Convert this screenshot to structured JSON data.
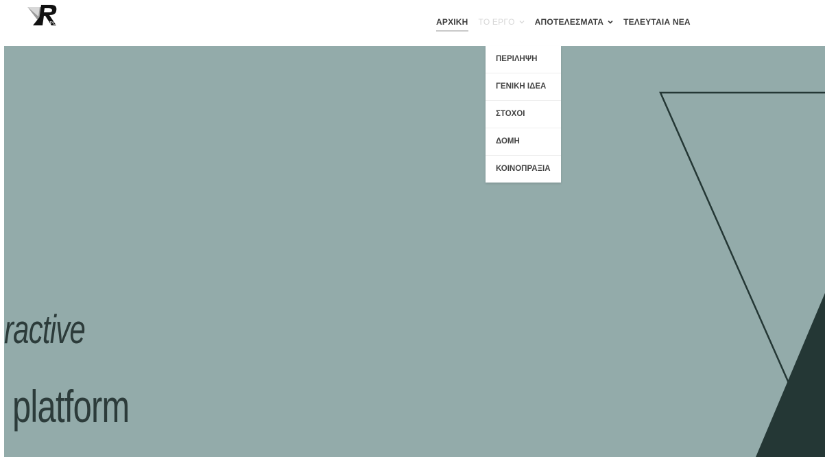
{
  "header": {
    "logo": {
      "icon": "vrexpo-logo-icon",
      "text": "EXPO"
    },
    "nav": [
      {
        "label": "ΑΡΧΙΚΗ",
        "active": true,
        "has_dropdown": false
      },
      {
        "label": "ΤΟ ΕΡΓΟ",
        "active": false,
        "has_dropdown": true,
        "dimmed": true
      },
      {
        "label": "ΑΠΟΤΕΛΕΣΜΑΤΑ",
        "active": false,
        "has_dropdown": true
      },
      {
        "label": "ΤΕΛΕΥΤΑΙΑ ΝΕΑ",
        "active": false,
        "has_dropdown": false
      }
    ]
  },
  "dropdown": {
    "items": [
      {
        "label": "ΠΕΡΙΛΗΨΗ"
      },
      {
        "label": "ΓΕΝΙΚΗ ΙΔΕΑ"
      },
      {
        "label": "ΣΤΟΧΟΙ"
      },
      {
        "label": "ΔΟΜΗ"
      },
      {
        "label": "ΚΟΙΝΟΠΡΑΞΙΑ"
      }
    ]
  },
  "hero": {
    "line1": "ractive",
    "line2": "platform",
    "colors": {
      "background": "#93abaa",
      "dark": "#243735"
    }
  }
}
